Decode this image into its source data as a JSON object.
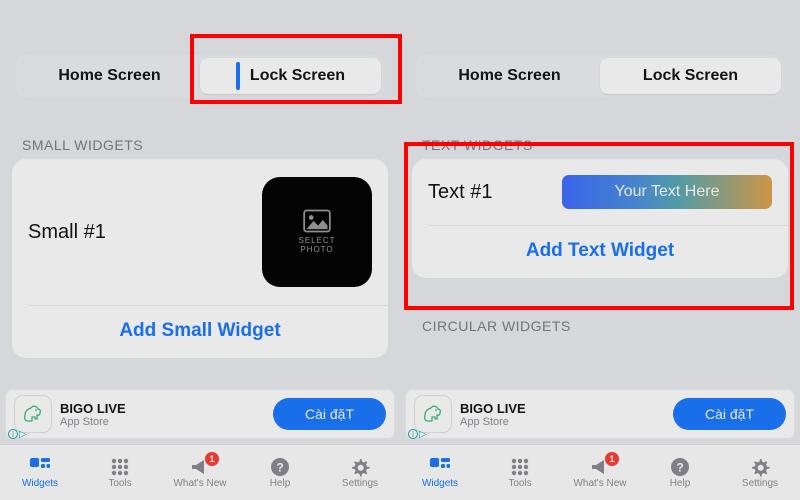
{
  "segments": {
    "home": "Home Screen",
    "lock": "Lock Screen"
  },
  "left": {
    "section": "SMALL WIDGETS",
    "item": "Small #1",
    "thumb_caption_l1": "SELECT",
    "thumb_caption_l2": "PHOTO",
    "add": "Add Small Widget"
  },
  "right": {
    "section": "TEXT WIDGETS",
    "item": "Text #1",
    "grad_label": "Your Text Here",
    "add": "Add Text Widget",
    "section2": "CIRCULAR WIDGETS"
  },
  "ad": {
    "title": "BIGO LIVE",
    "sub": "App Store",
    "cta": "Cài đặT",
    "info": "i",
    "close": "▷"
  },
  "tabs": {
    "widgets": "Widgets",
    "tools": "Tools",
    "whatsnew": "What's New",
    "help": "Help",
    "settings": "Settings",
    "badge": "1"
  }
}
